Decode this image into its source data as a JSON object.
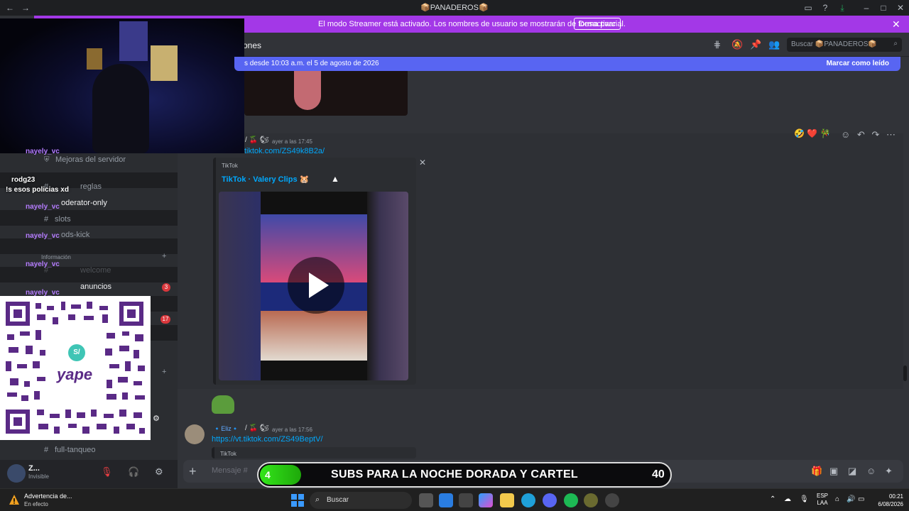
{
  "window": {
    "title": "📦PANADEROS📦"
  },
  "streamer_banner": {
    "message": "El modo Streamer está activado. Los nombres de usuario se mostrarán de forma parcial.",
    "button": "Desactivar",
    "close": "✕"
  },
  "channel_header": {
    "name": "ones",
    "search_placeholder": "Buscar 📦PANADEROS📦"
  },
  "new_messages_bar": {
    "text": "s desde 10:03 a.m. el 5 de agosto de 2026",
    "action": "Marcar como leído"
  },
  "message1": {
    "timestamp": "ayer a las 17:45",
    "link": "tiktok.com/ZS49k8B2a/",
    "embed": {
      "provider": "TikTok",
      "title": "TikTok · Valery Clips 🐹",
      "close": "✕"
    },
    "reactions": [
      "🤣",
      "❤️",
      "🎋"
    ]
  },
  "message2": {
    "author": "🔹Eliz🔹",
    "timestamp": "ayer a las 17:56",
    "link": "https://vt.tiktok.com/ZS49BeptV/",
    "embed_provider": "TikTok"
  },
  "composer": {
    "placeholder": "Mensaje #"
  },
  "sidebar": {
    "channels": {
      "mejoras": "Mejoras del servidor",
      "reglas": "reglas",
      "moderator": "oderator-only",
      "slots": "slots",
      "mods_kick": "ods-kick",
      "category": "Información",
      "welcome": "welcome",
      "anuncios": "anuncios",
      "full_tanqueo": "full-tanqueo"
    },
    "badges": {
      "anuncios": "3",
      "other": "17"
    }
  },
  "chat_overlay": {
    "names": [
      "nayely_vc",
      "rodg23",
      "nayely_vc",
      "nayely_vc",
      "nayely_vc",
      "nayely_vc"
    ],
    "message": "!s esos policias xd"
  },
  "qr": {
    "brand": "yape",
    "logo_text": "S/"
  },
  "user_panel": {
    "name": "Z...",
    "status": "Invisible"
  },
  "subs_goal": {
    "current": "4",
    "label": "SUBS PARA LA NOCHE DORADA Y CARTEL",
    "goal": "40",
    "progress": 0.1
  },
  "taskbar": {
    "warning_title": "Advertencia de...",
    "warning_sub": "En efecto",
    "search": "Buscar",
    "lang_line1": "ESP",
    "lang_line2": "LAA",
    "time": "00:21",
    "date": "6/08/2026"
  },
  "colors": {
    "streamer_banner": "#a338e7",
    "new_messages": "#5865f2",
    "link": "#00a8fc",
    "subs_fill": "#33e61a",
    "qr": "#5a2a86"
  }
}
